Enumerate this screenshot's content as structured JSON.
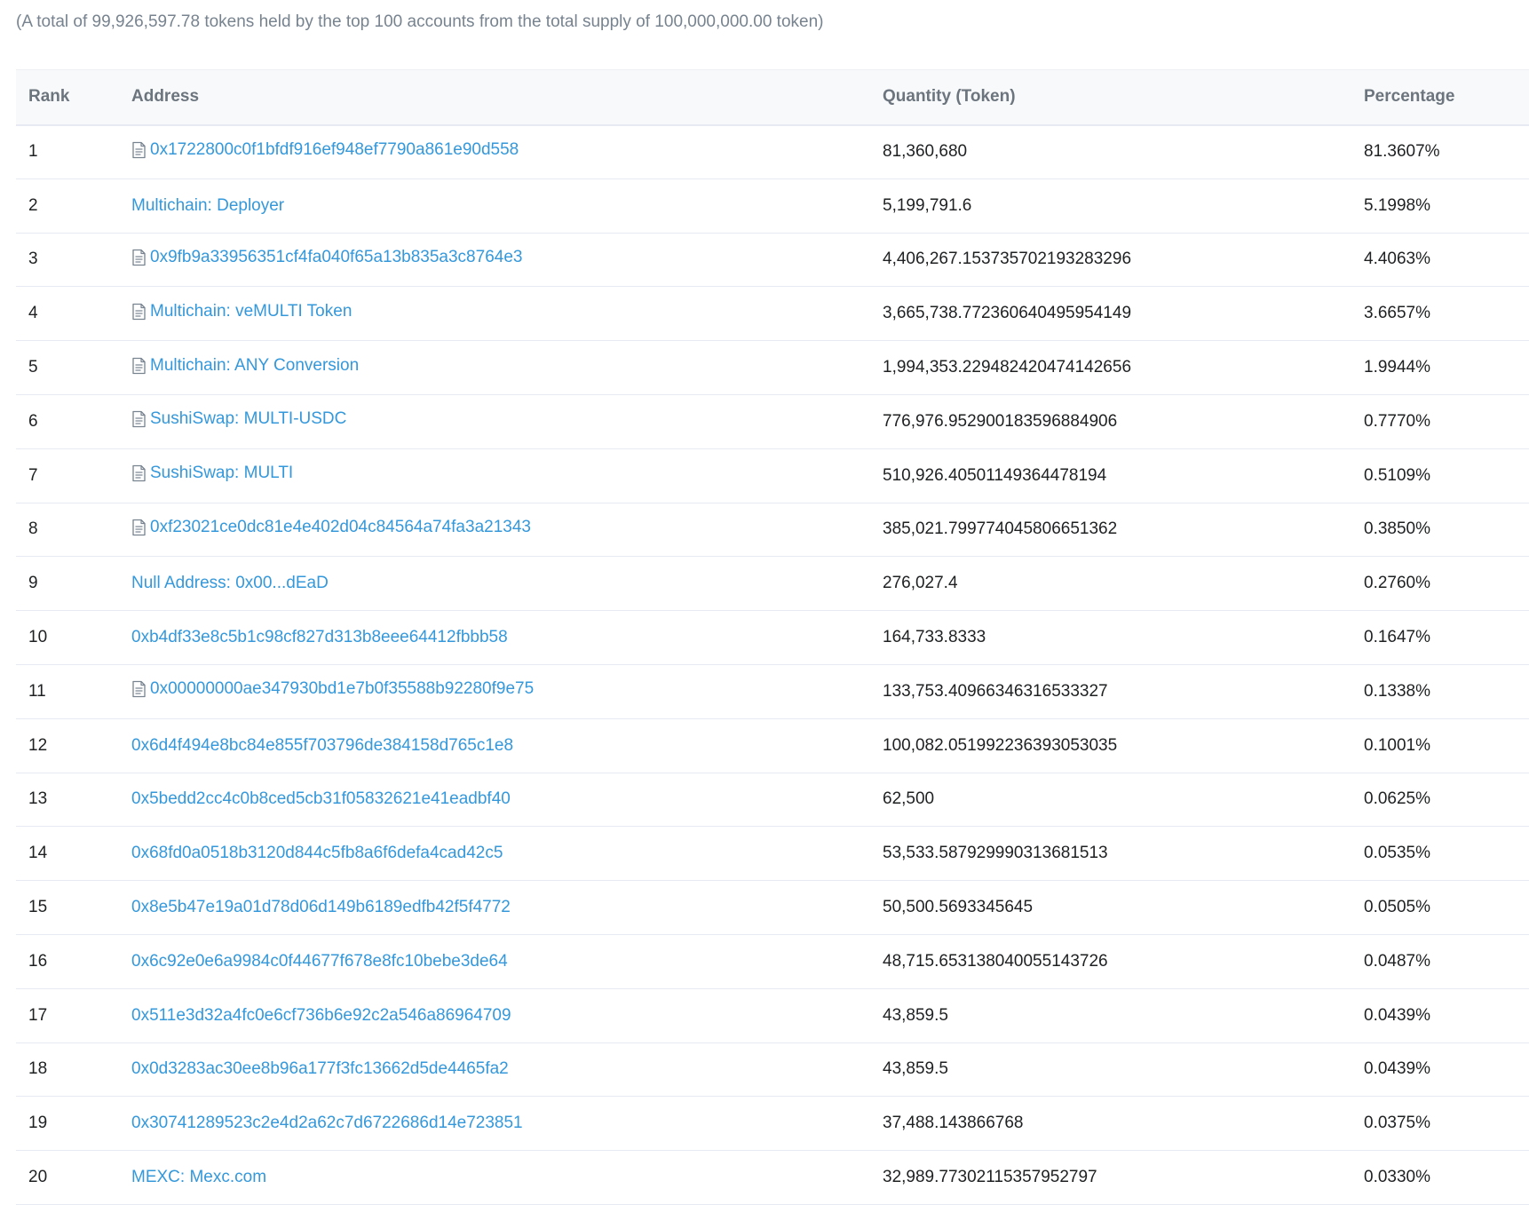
{
  "summary_text": "(A total of 99,926,597.78 tokens held by the top 100 accounts from the total supply of 100,000,000.00 token)",
  "table": {
    "headers": {
      "rank": "Rank",
      "address": "Address",
      "quantity": "Quantity (Token)",
      "percentage": "Percentage"
    },
    "rows": [
      {
        "rank": "1",
        "address": "0x1722800c0f1bfdf916ef948ef7790a861e90d558",
        "contract_icon": true,
        "quantity": "81,360,680",
        "percentage": "81.3607%"
      },
      {
        "rank": "2",
        "address": "Multichain: Deployer",
        "contract_icon": false,
        "quantity": "5,199,791.6",
        "percentage": "5.1998%"
      },
      {
        "rank": "3",
        "address": "0x9fb9a33956351cf4fa040f65a13b835a3c8764e3",
        "contract_icon": true,
        "quantity": "4,406,267.153735702193283296",
        "percentage": "4.4063%"
      },
      {
        "rank": "4",
        "address": "Multichain: veMULTI Token",
        "contract_icon": true,
        "quantity": "3,665,738.772360640495954149",
        "percentage": "3.6657%"
      },
      {
        "rank": "5",
        "address": "Multichain: ANY Conversion",
        "contract_icon": true,
        "quantity": "1,994,353.229482420474142656",
        "percentage": "1.9944%"
      },
      {
        "rank": "6",
        "address": "SushiSwap: MULTI-USDC",
        "contract_icon": true,
        "quantity": "776,976.952900183596884906",
        "percentage": "0.7770%"
      },
      {
        "rank": "7",
        "address": "SushiSwap: MULTI",
        "contract_icon": true,
        "quantity": "510,926.40501149364478194",
        "percentage": "0.5109%"
      },
      {
        "rank": "8",
        "address": "0xf23021ce0dc81e4e402d04c84564a74fa3a21343",
        "contract_icon": true,
        "quantity": "385,021.799774045806651362",
        "percentage": "0.3850%"
      },
      {
        "rank": "9",
        "address": "Null Address: 0x00...dEaD",
        "contract_icon": false,
        "quantity": "276,027.4",
        "percentage": "0.2760%"
      },
      {
        "rank": "10",
        "address": "0xb4df33e8c5b1c98cf827d313b8eee64412fbbb58",
        "contract_icon": false,
        "quantity": "164,733.8333",
        "percentage": "0.1647%"
      },
      {
        "rank": "11",
        "address": "0x00000000ae347930bd1e7b0f35588b92280f9e75",
        "contract_icon": true,
        "quantity": "133,753.40966346316533327",
        "percentage": "0.1338%"
      },
      {
        "rank": "12",
        "address": "0x6d4f494e8bc84e855f703796de384158d765c1e8",
        "contract_icon": false,
        "quantity": "100,082.051992236393053035",
        "percentage": "0.1001%"
      },
      {
        "rank": "13",
        "address": "0x5bedd2cc4c0b8ced5cb31f05832621e41eadbf40",
        "contract_icon": false,
        "quantity": "62,500",
        "percentage": "0.0625%"
      },
      {
        "rank": "14",
        "address": "0x68fd0a0518b3120d844c5fb8a6f6defa4cad42c5",
        "contract_icon": false,
        "quantity": "53,533.587929990313681513",
        "percentage": "0.0535%"
      },
      {
        "rank": "15",
        "address": "0x8e5b47e19a01d78d06d149b6189edfb42f5f4772",
        "contract_icon": false,
        "quantity": "50,500.5693345645",
        "percentage": "0.0505%"
      },
      {
        "rank": "16",
        "address": "0x6c92e0e6a9984c0f44677f678e8fc10bebe3de64",
        "contract_icon": false,
        "quantity": "48,715.653138040055143726",
        "percentage": "0.0487%"
      },
      {
        "rank": "17",
        "address": "0x511e3d32a4fc0e6cf736b6e92c2a546a86964709",
        "contract_icon": false,
        "quantity": "43,859.5",
        "percentage": "0.0439%"
      },
      {
        "rank": "18",
        "address": "0x0d3283ac30ee8b96a177f3fc13662d5de4465fa2",
        "contract_icon": false,
        "quantity": "43,859.5",
        "percentage": "0.0439%"
      },
      {
        "rank": "19",
        "address": "0x30741289523c2e4d2a62c7d6722686d14e723851",
        "contract_icon": false,
        "quantity": "37,488.143866768",
        "percentage": "0.0375%"
      },
      {
        "rank": "20",
        "address": "MEXC: Mexc.com",
        "contract_icon": false,
        "quantity": "32,989.77302115357952797",
        "percentage": "0.0330%"
      }
    ]
  },
  "colors": {
    "link": "#3498db",
    "text": "#1e2022",
    "muted": "#77838f",
    "header_bg": "#f8f9fa",
    "border": "#e7eaf3"
  },
  "icons": {
    "contract": "contract-document-icon"
  }
}
